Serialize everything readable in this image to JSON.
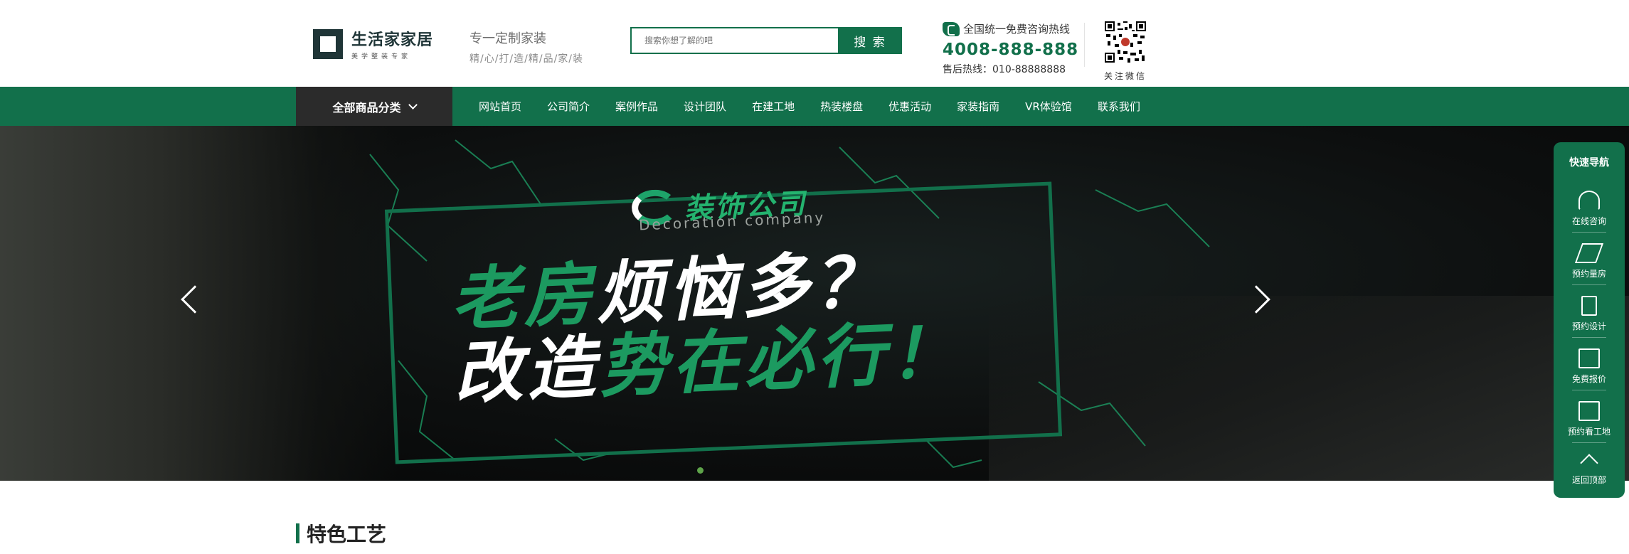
{
  "header": {
    "logo_name": "生活家家居",
    "logo_sub": "美学整装专家",
    "slogan_line1": "专一定制家装",
    "slogan_line2": "精/心/打/造/精/品/家/装",
    "search": {
      "placeholder": "搜索你想了解的吧",
      "button_label": "搜 索"
    },
    "hotline": {
      "label": "全国统一免费咨询热线",
      "number": "4008-888-888",
      "after_sales": "售后热线：010-88888888"
    },
    "qr_label": "关注微信"
  },
  "nav": {
    "category_label": "全部商品分类",
    "items": [
      "网站首页",
      "公司简介",
      "案例作品",
      "设计团队",
      "在建工地",
      "热装楼盘",
      "优惠活动",
      "家装指南",
      "VR体验馆",
      "联系我们"
    ]
  },
  "banner": {
    "brand_name": "装饰公司",
    "brand_en": "Decoration company",
    "headline_line1_green": "老房",
    "headline_line1_white": "烦恼多？",
    "headline_line2_white": "改造",
    "headline_line2_green": "势在必行！",
    "slide_count": 1,
    "active_slide": 1
  },
  "section": {
    "title": "特色工艺"
  },
  "quicknav": {
    "title": "快速导航",
    "items": [
      {
        "label": "在线咨询",
        "icon": "headset-icon"
      },
      {
        "label": "预约量房",
        "icon": "ruler-icon"
      },
      {
        "label": "预约设计",
        "icon": "pencil-icon"
      },
      {
        "label": "免费报价",
        "icon": "calculator-icon"
      },
      {
        "label": "预约看工地",
        "icon": "mail-icon"
      },
      {
        "label": "返回顶部",
        "icon": "arrow-up-icon"
      }
    ]
  },
  "colors": {
    "brand_green": "#12704b",
    "accent_green": "#1c9a60",
    "category_dark": "#2b2b2b"
  }
}
